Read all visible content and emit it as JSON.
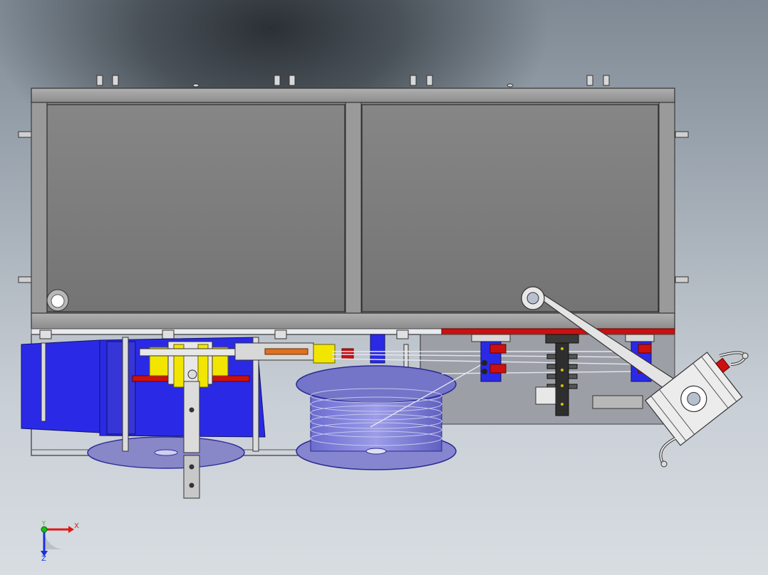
{
  "view": {
    "background_top": "#4a5259",
    "background_bottom": "#d8dde2",
    "frame_color": "#808080",
    "panel_color": "#7d7d7d",
    "accent_blue": "#2424e0",
    "accent_yellow": "#f2e600",
    "accent_red": "#cc1010",
    "cable_color": "#d8d8ec"
  },
  "triad": {
    "x_label": "X",
    "y_label": "Y",
    "z_label": "Z",
    "x_color": "#e01818",
    "y_color": "#18c018",
    "z_color": "#1830e0"
  }
}
